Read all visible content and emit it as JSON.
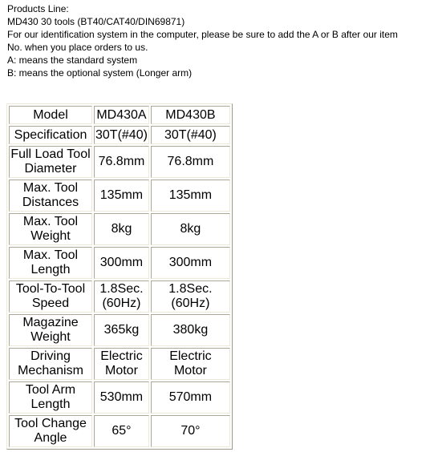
{
  "intro": {
    "lines": [
      "Products Line:",
      "MD430 30 tools (BT40/CAT40/DIN69871)",
      "For our identification system in the computer, please be sure to add the A or B after our item",
      "No. when you place orders to us.",
      "A: means the standard system",
      "B: means the optional system (Longer arm)"
    ]
  },
  "table": {
    "headers": [
      "Model",
      "MD430A",
      "MD430B"
    ],
    "rows": [
      {
        "label": [
          "Specification"
        ],
        "a": [
          "30T(#40)"
        ],
        "b": [
          "30T(#40)"
        ]
      },
      {
        "label": [
          "Full Load Tool",
          "Diameter"
        ],
        "a": [
          "76.8mm"
        ],
        "b": [
          "76.8mm"
        ]
      },
      {
        "label": [
          "Max. Tool",
          "Distances"
        ],
        "a": [
          "135mm"
        ],
        "b": [
          "135mm"
        ]
      },
      {
        "label": [
          "Max. Tool",
          "Weight"
        ],
        "a": [
          "8kg"
        ],
        "b": [
          "8kg"
        ]
      },
      {
        "label": [
          "Max. Tool",
          "Length"
        ],
        "a": [
          "300mm"
        ],
        "b": [
          "300mm"
        ]
      },
      {
        "label": [
          "Tool-To-Tool",
          "Speed"
        ],
        "a": [
          "1.8Sec.",
          "(60Hz)"
        ],
        "b": [
          "1.8Sec.",
          "(60Hz)"
        ]
      },
      {
        "label": [
          "Magazine",
          "Weight"
        ],
        "a": [
          "365kg"
        ],
        "b": [
          "380kg"
        ]
      },
      {
        "label": [
          "Driving",
          "Mechanism"
        ],
        "a": [
          "Electric",
          "Motor"
        ],
        "b": [
          "Electric",
          "Motor"
        ]
      },
      {
        "label": [
          "Tool Arm",
          "Length"
        ],
        "a": [
          "530mm"
        ],
        "b": [
          "570mm"
        ]
      },
      {
        "label": [
          "Tool Change",
          "Angle"
        ],
        "a": [
          "65°"
        ],
        "b": [
          "70°"
        ]
      }
    ]
  }
}
